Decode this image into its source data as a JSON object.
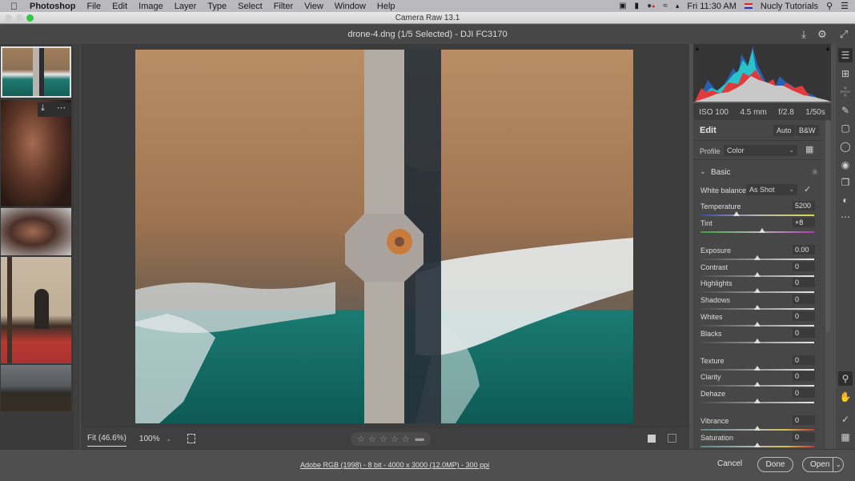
{
  "menubar": {
    "app_name": "Photoshop",
    "items": [
      "File",
      "Edit",
      "Image",
      "Layer",
      "Type",
      "Select",
      "Filter",
      "View",
      "Window",
      "Help"
    ],
    "clock": "Fri 11:30 AM",
    "user": "Nucly Tutorials"
  },
  "window": {
    "title": "Camera Raw 13.1",
    "file_info": "drone-4.dng (1/5 Selected)  -  DJI FC3170"
  },
  "histogram": {
    "iso": "ISO 100",
    "focal": "4.5 mm",
    "aperture": "f/2.8",
    "shutter": "1/50s"
  },
  "edit": {
    "title": "Edit",
    "auto_label": "Auto",
    "bw_label": "B&W",
    "profile_label": "Profile",
    "profile_value": "Color",
    "basic_title": "Basic",
    "wb_label": "White balance",
    "wb_value": "As Shot",
    "sliders": [
      {
        "label": "Temperature",
        "value": "5200",
        "pos": 0.32
      },
      {
        "label": "Tint",
        "value": "+8",
        "pos": 0.54
      },
      {
        "label": "Exposure",
        "value": "0.00",
        "pos": 0.5
      },
      {
        "label": "Contrast",
        "value": "0",
        "pos": 0.5
      },
      {
        "label": "Highlights",
        "value": "0",
        "pos": 0.5
      },
      {
        "label": "Shadows",
        "value": "0",
        "pos": 0.5
      },
      {
        "label": "Whites",
        "value": "0",
        "pos": 0.5
      },
      {
        "label": "Blacks",
        "value": "0",
        "pos": 0.5
      },
      {
        "label": "Texture",
        "value": "0",
        "pos": 0.5
      },
      {
        "label": "Clarity",
        "value": "0",
        "pos": 0.5
      },
      {
        "label": "Dehaze",
        "value": "0",
        "pos": 0.5
      },
      {
        "label": "Vibrance",
        "value": "0",
        "pos": 0.5
      },
      {
        "label": "Saturation",
        "value": "0",
        "pos": 0.5
      }
    ]
  },
  "view": {
    "fit_label": "Fit (46.6%)",
    "zoom_label": "100%",
    "rating_stars": 0
  },
  "footer": {
    "info": "Adobe RGB (1998) - 8 bit - 4000 x 3000 (12.0MP) - 300 ppi",
    "cancel": "Cancel",
    "done": "Done",
    "open": "Open"
  },
  "filmstrip": {
    "count": 5,
    "selected_index": 0
  }
}
